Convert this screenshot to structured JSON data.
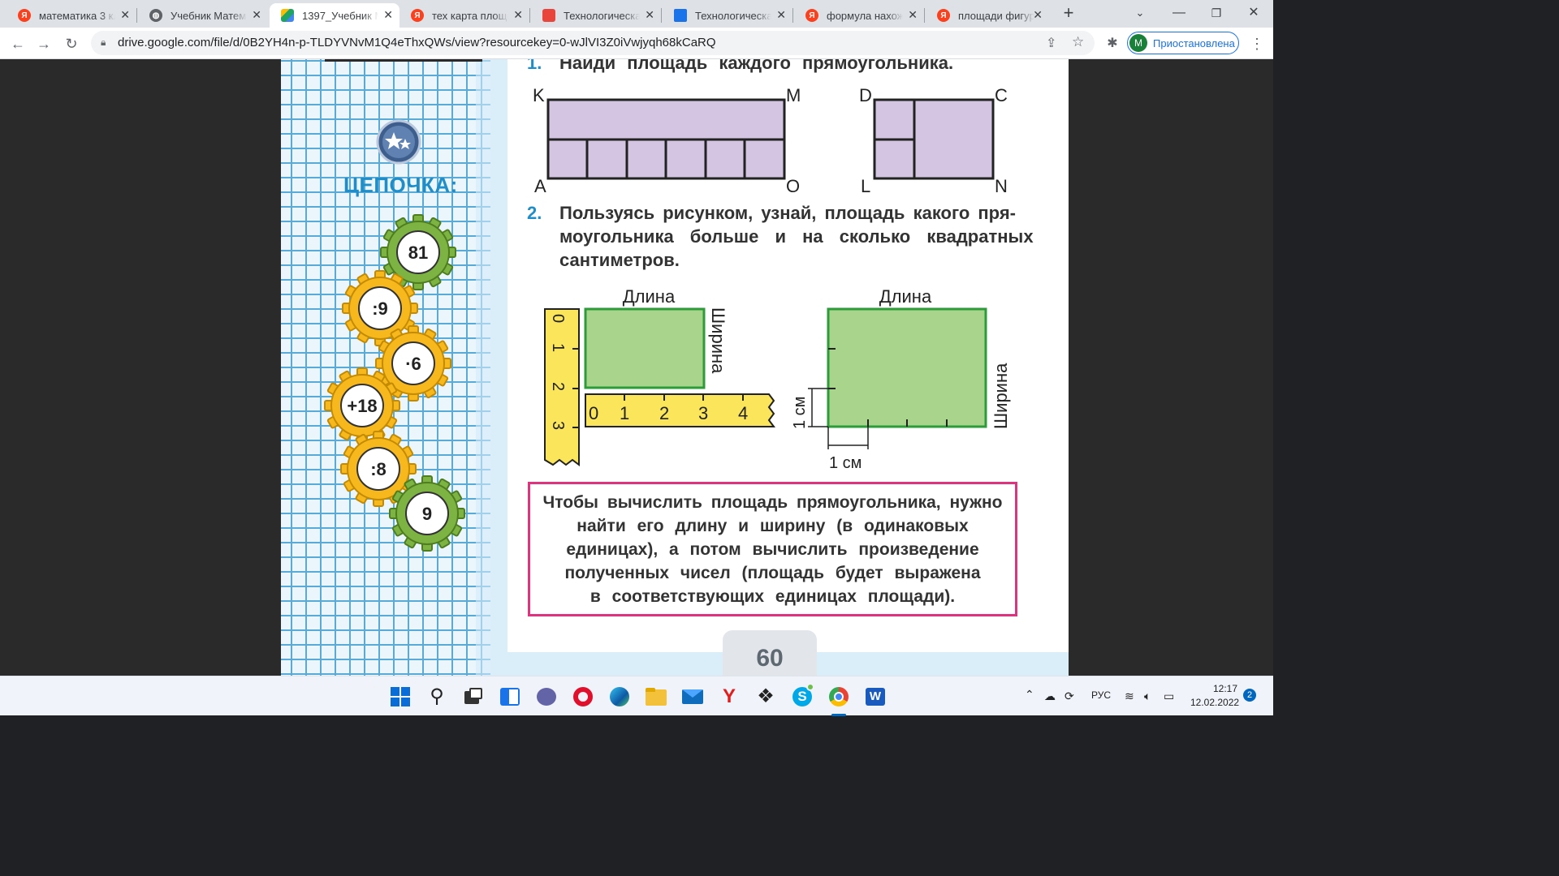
{
  "browser": {
    "tabs": [
      {
        "title": "математика 3 кла",
        "favicon": "yandex-icon",
        "color": "#fc3f1d",
        "active": false
      },
      {
        "title": "Учебник Матема",
        "favicon": "globe-icon",
        "color": "#5f6368",
        "active": false
      },
      {
        "title": "1397_Учебник М",
        "favicon": "google-drive-icon",
        "color": "#1fa463",
        "active": true
      },
      {
        "title": "тех карта площа",
        "favicon": "yandex-icon",
        "color": "#fc3f1d",
        "active": false
      },
      {
        "title": "Технологическая",
        "favicon": "briefcase-icon",
        "color": "#e8453c",
        "active": false
      },
      {
        "title": "Технологическая",
        "favicon": "book-icon",
        "color": "#1a73e8",
        "active": false
      },
      {
        "title": "формула нахожд",
        "favicon": "yandex-icon",
        "color": "#fc3f1d",
        "active": false
      },
      {
        "title": "площади фигур -",
        "favicon": "yandex-icon",
        "color": "#fc3f1d",
        "active": false
      }
    ],
    "url": "drive.google.com/file/d/0B2YH4n-p-TLDYVNvM1Q4eThxQWs/view?resourcekey=0-wJlVI3Z0iVwjyqh68kCaRQ",
    "profile": {
      "initial": "M",
      "label": "Приостановлена"
    }
  },
  "textbook": {
    "chain_title": "ЦЕПОЧКА:",
    "gears": [
      "81",
      ":9",
      "·6",
      "+18",
      ":8",
      "9"
    ],
    "task1": {
      "number": "1.",
      "text": "Найди площадь каждого прямоугольника.",
      "labels": {
        "K": "K",
        "M": "M",
        "A": "A",
        "O": "O",
        "D": "D",
        "C": "C",
        "L": "L",
        "N": "N"
      }
    },
    "task2": {
      "number": "2.",
      "line1": "Пользуясь рисунком, узнай, площадь какого пря-",
      "line2": "моугольника больше и на сколько квадратных",
      "line3": "сантиметров.",
      "length_label": "Длина",
      "width_label": "Ширина",
      "cm_label": "1 см",
      "ruler_ticks": [
        "0",
        "1",
        "2",
        "3",
        "4"
      ],
      "ruler_vertical_ticks": [
        "0",
        "1",
        "2",
        "3"
      ]
    },
    "rule": {
      "line1": "Чтобы вычислить площадь прямоугольника, нужно",
      "line2": "найти его длину и ширину (в одинаковых",
      "line3": "единицах), а потом вычислить произведение",
      "line4": "полученных чисел (площадь будет выражена",
      "line5": "в соответствующих единицах площади)."
    },
    "page_number": "60"
  },
  "taskbar": {
    "apps": [
      "windows-start-icon",
      "search-icon",
      "task-view-icon",
      "widgets-icon",
      "teams-chat-icon",
      "opera-icon",
      "edge-icon",
      "file-explorer-icon",
      "mail-icon",
      "yandex-browser-icon",
      "dropbox-icon",
      "skype-icon",
      "chrome-icon",
      "word-icon"
    ],
    "language": "РУС",
    "time": "12:17",
    "date": "12.02.2022",
    "notifications": "2"
  }
}
